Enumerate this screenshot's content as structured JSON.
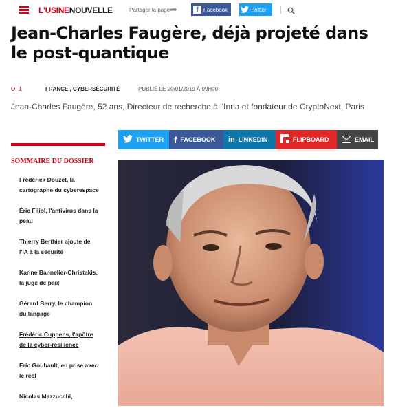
{
  "header": {
    "logo_part1": "L'USINE",
    "logo_part2": "NOUVELLE",
    "share_label": "Partager la page",
    "facebook_label": "Facebook",
    "twitter_label": "Twitter"
  },
  "article": {
    "title": "Jean-Charles Faugère, déjà projeté dans le post-quantique",
    "author": "O. J.",
    "categories": "FRANCE , CYBERSÉCURITÉ",
    "published": "PUBLIÉ LE 20/01/2019 À 09H00",
    "subtitle": "Jean-Charles Faugère, 52 ans, Directeur de recherche à l'Inria et fondateur de CryptoNext, Paris"
  },
  "share_bar": {
    "twitter": "TWITTER",
    "facebook": "FACEBOOK",
    "linkedin": "LINKEDIN",
    "flipboard": "FLIPBOARD",
    "email": "EMAIL"
  },
  "sidebar": {
    "heading": "SOMMAIRE DU DOSSIER",
    "items": [
      {
        "label": "Frédérick Douzet, la cartographe du cyberespace"
      },
      {
        "label": "Éric Filiol, l'antivirus dans la peau"
      },
      {
        "label": "Thierry Berthier ajoute de l'IA à la sécurité"
      },
      {
        "label": "Karine Bannelier-Christakis, la juge de paix"
      },
      {
        "label": "Gérard Berry, le champion du langage"
      },
      {
        "label": "Frédéric Cuppens, l'apôtre de la cyber-résilience"
      },
      {
        "label": "Eric Goubault, en prise avec le réel"
      },
      {
        "label": "Nicolas Mazzucchi,"
      }
    ]
  },
  "colors": {
    "brand_red": "#d0021b",
    "twitter": "#1da1f2",
    "facebook": "#3b5998",
    "linkedin": "#0e76a8",
    "flipboard": "#e12828",
    "email": "#444444"
  },
  "icons": [
    "menu-icon",
    "share-arrow-icon",
    "facebook-icon",
    "twitter-icon",
    "search-icon",
    "linkedin-icon",
    "flipboard-icon",
    "email-icon"
  ]
}
